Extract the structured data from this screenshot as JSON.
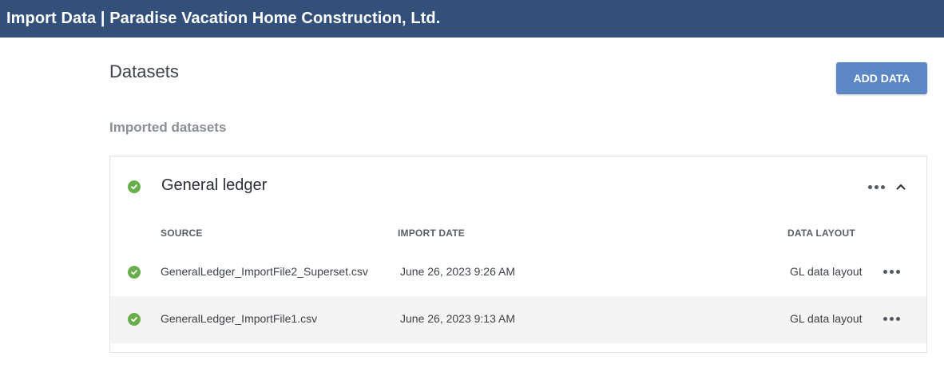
{
  "header": {
    "title": "Import Data | Paradise Vacation Home Construction, Ltd."
  },
  "page": {
    "title": "Datasets",
    "add_button_label": "ADD DATA",
    "section_label": "Imported datasets"
  },
  "dataset": {
    "name": "General ledger",
    "status_icon": "check-circle-icon",
    "columns": {
      "source": "SOURCE",
      "import_date": "IMPORT DATE",
      "data_layout": "DATA LAYOUT"
    },
    "rows": [
      {
        "source": "GeneralLedger_ImportFile2_Superset.csv",
        "import_date": "June 26, 2023 9:26 AM",
        "data_layout": "GL data layout"
      },
      {
        "source": "GeneralLedger_ImportFile1.csv",
        "import_date": "June 26, 2023 9:13 AM",
        "data_layout": "GL data layout"
      }
    ]
  },
  "colors": {
    "header_bg": "#33507a",
    "button_bg": "#5b87c5",
    "success": "#6aad4b",
    "row_alt_bg": "#f4f4f4"
  }
}
